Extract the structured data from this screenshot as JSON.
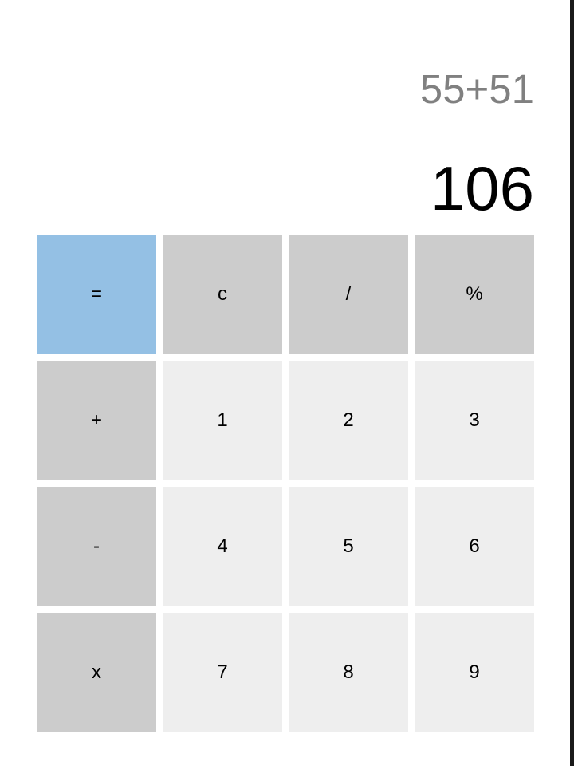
{
  "display": {
    "expression": "55+51",
    "result": "106"
  },
  "keys": {
    "equals": "=",
    "clear": "c",
    "divide": "/",
    "percent": "%",
    "plus": "+",
    "minus": "-",
    "multiply": "x",
    "one": "1",
    "two": "2",
    "three": "3",
    "four": "4",
    "five": "5",
    "six": "6",
    "seven": "7",
    "eight": "8",
    "nine": "9"
  },
  "colors": {
    "equals_key": "#94c0e4",
    "operator_key": "#cccccc",
    "digit_key": "#eeeeee",
    "expression_text": "#808080",
    "result_text": "#000000"
  }
}
